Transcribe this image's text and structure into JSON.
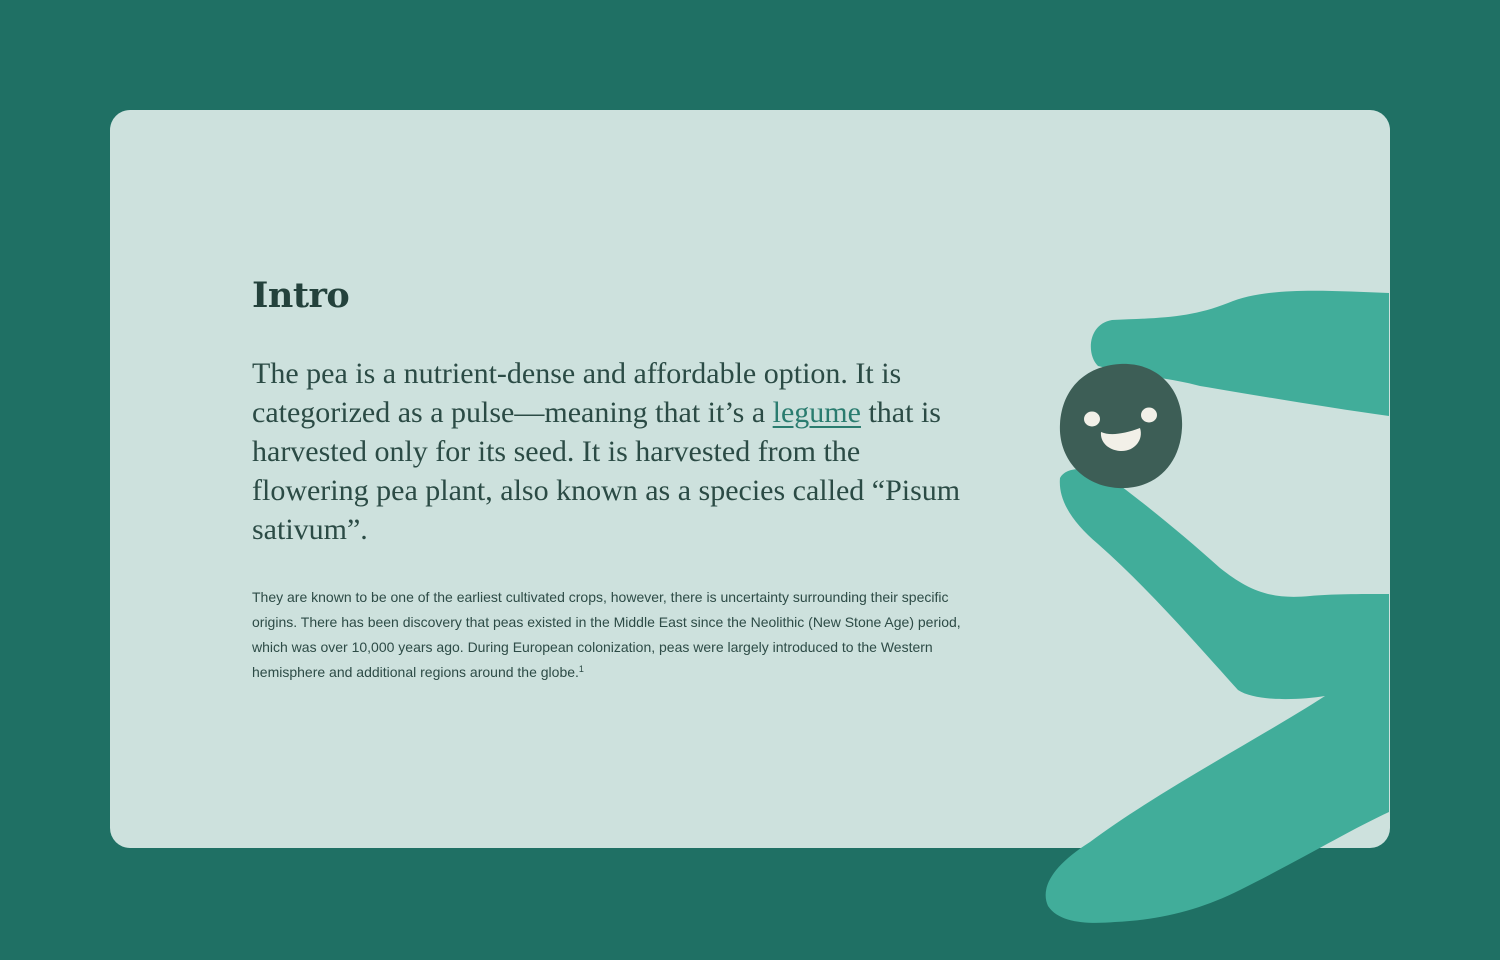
{
  "intro": {
    "heading": "Intro",
    "lead": {
      "before_link": "The pea is a nutrient-dense and affordable option. It is categorized as a pulse—meaning that it’s a ",
      "link_text": "legume",
      "after_link": " that is harvested only for its seed. It is harvested from the flowering pea plant, also known as a species called “Pisum sativum”."
    },
    "body": "They are known to be one of the earliest cultivated crops, however, there is uncertainty surrounding their specific origins. There has been discovery that peas existed in the Middle East since the Neolithic (New Stone Age) period, which was over 10,000 years ago. During European colonization, peas were largely introduced to the Western hemisphere and additional regions around the globe.",
    "footnote_marker": "1"
  },
  "illustration": {
    "subject": "hand-holding-smiling-pea-illustration",
    "colors": {
      "hand": "#41ad9a",
      "pea": "#3d5e56",
      "face": "#f2f0e8"
    }
  },
  "colors": {
    "page_background": "#1f7064",
    "card_background": "#cde1dd",
    "text": "#25433d",
    "link": "#2a7c6f"
  }
}
